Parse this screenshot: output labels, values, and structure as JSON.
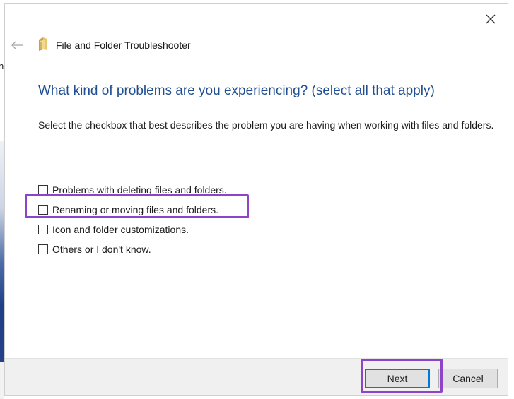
{
  "window": {
    "title": "File and Folder Troubleshooter"
  },
  "page": {
    "heading": "What kind of problems are you experiencing? (select all that apply)",
    "description": "Select the checkbox that best describes the problem you are having when working with files and folders."
  },
  "options": [
    {
      "label": "Problems with deleting files and folders.",
      "checked": false
    },
    {
      "label": "Renaming or moving files and folders.",
      "checked": false
    },
    {
      "label": "Icon and folder customizations.",
      "checked": false
    },
    {
      "label": "Others or I don't know.",
      "checked": false
    }
  ],
  "buttons": {
    "next": "Next",
    "cancel": "Cancel"
  },
  "desktop": {
    "edge_glyph": "n"
  },
  "icons": {
    "close": "close-icon",
    "back": "back-arrow-icon",
    "app": "folder-icon"
  },
  "colors": {
    "heading": "#1f4e91",
    "highlight": "#8e44c9",
    "primary_button_border": "#0078d7"
  }
}
